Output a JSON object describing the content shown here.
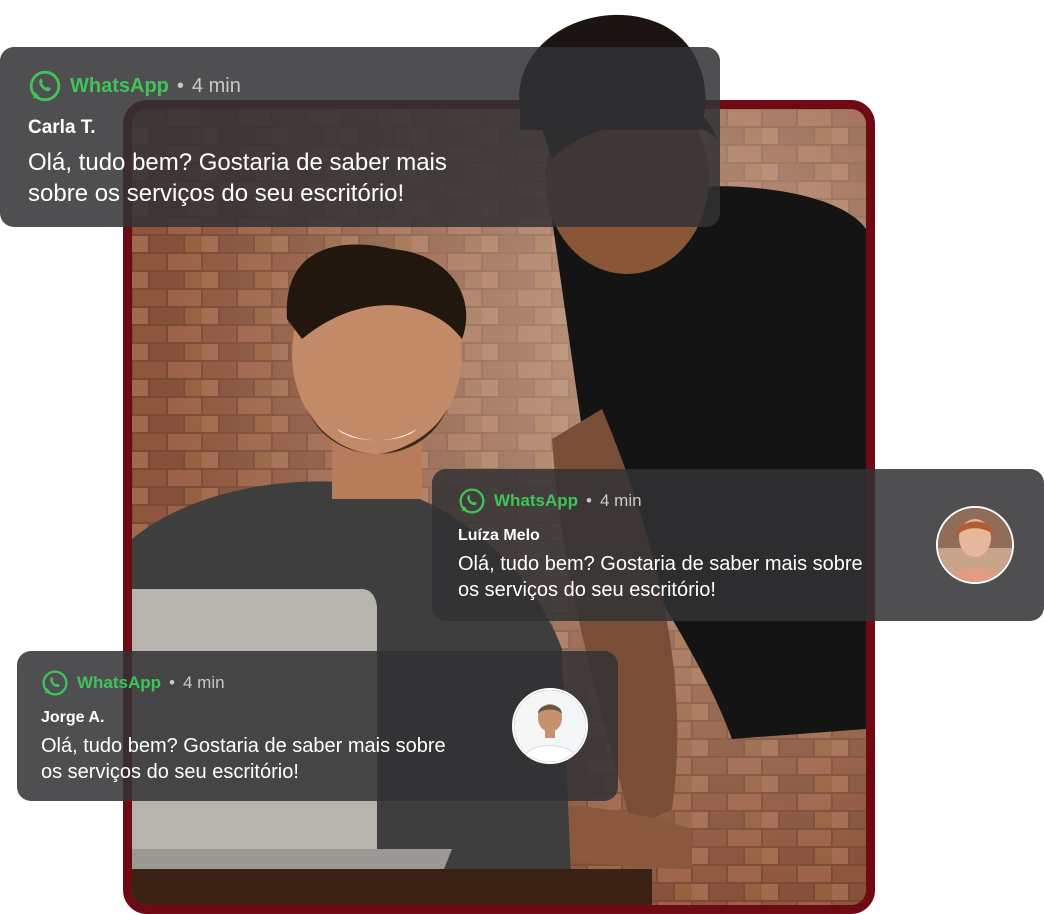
{
  "brand": {
    "frame_color": "#6e0a14",
    "whatsapp_green": "#3ec55a",
    "card_background": "#323234"
  },
  "notifications": [
    {
      "app": "WhatsApp",
      "separator": "•",
      "time": "4 min",
      "sender": "Carla T.",
      "message": "Olá, tudo bem? Gostaria de saber mais sobre os serviços do seu escritório!",
      "icon": "whatsapp-icon",
      "avatar": false
    },
    {
      "app": "WhatsApp",
      "separator": "•",
      "time": "4 min",
      "sender": "Luíza Melo",
      "message": "Olá, tudo bem? Gostaria de saber mais sobre os serviços do seu escritório!",
      "icon": "whatsapp-icon",
      "avatar": true
    },
    {
      "app": "WhatsApp",
      "separator": "•",
      "time": "4 min",
      "sender": "Jorge A.",
      "message": "Olá, tudo bem? Gostaria de saber mais sobre os serviços do seu escritório!",
      "icon": "whatsapp-icon",
      "avatar": true
    }
  ]
}
